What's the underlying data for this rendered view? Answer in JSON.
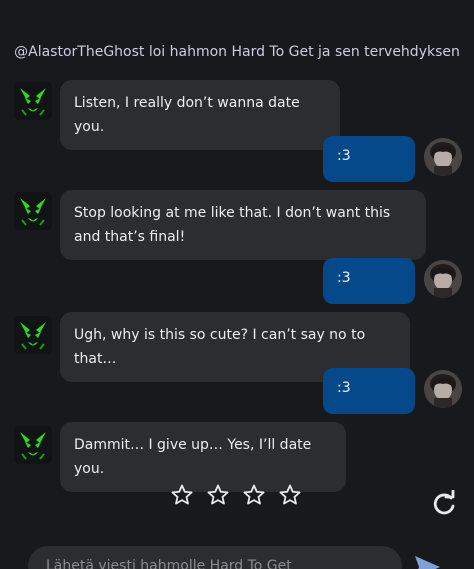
{
  "header": {
    "text": "@AlastorTheGhost loi hahmon Hard To Get ja sen tervehdyksen"
  },
  "messages": [
    {
      "role": "bot",
      "text": "Listen, I really don’t wanna date you."
    },
    {
      "role": "user",
      "text": ":3"
    },
    {
      "role": "bot",
      "text": "Stop looking at me like that. I don’t want this and that’s final!"
    },
    {
      "role": "user",
      "text": ":3"
    },
    {
      "role": "bot",
      "text": "Ugh, why is this so cute? I can’t say no to that…"
    },
    {
      "role": "user",
      "text": ":3"
    },
    {
      "role": "bot",
      "text": "Dammit… I give up… Yes, I’ll date you."
    }
  ],
  "rating": {
    "max": 5,
    "value": 0,
    "icon": "star-outline-icon"
  },
  "composer": {
    "placeholder": "Lähetä viesti hahmolle Hard To Get"
  },
  "icons": {
    "regenerate": "refresh-icon",
    "send": "send-icon",
    "bot_avatar": "green-demon-face-icon"
  },
  "colors": {
    "background": "#18191c",
    "bot_bubble": "#2b2d31",
    "user_bubble": "#06498a",
    "bot_avatar_accent": "#2bdc1e"
  }
}
